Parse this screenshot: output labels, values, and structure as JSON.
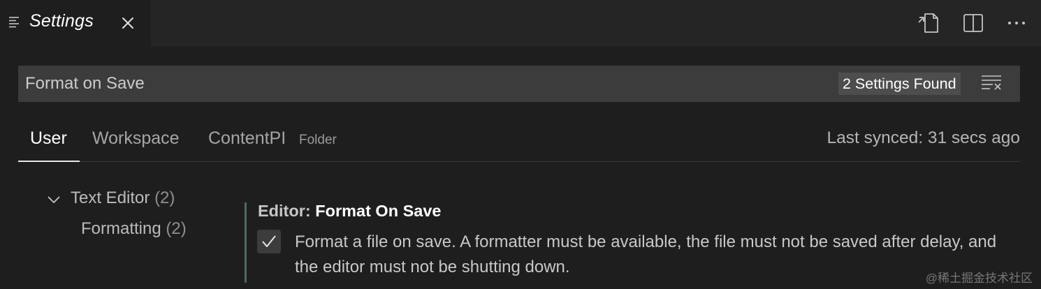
{
  "editor_tab": {
    "title": "Settings",
    "icon": "settings-editor-icon",
    "close_icon": "close-icon"
  },
  "actions": [
    {
      "name": "open-settings-json-button",
      "icon": "open-json-icon"
    },
    {
      "name": "split-editor-button",
      "icon": "split-editor-icon"
    },
    {
      "name": "more-actions-button",
      "icon": "ellipsis-icon"
    }
  ],
  "search": {
    "value": "Format on Save",
    "results_label": "2 Settings Found",
    "clear_icon": "clear-filter-icon"
  },
  "scope_tabs": [
    {
      "label": "User",
      "active": true
    },
    {
      "label": "Workspace",
      "active": false
    },
    {
      "label": "ContentPI",
      "active": false,
      "hint": "Folder"
    }
  ],
  "sync_status": "Last synced: 31 secs ago",
  "toc": {
    "group": {
      "label": "Text Editor",
      "count": "(2)"
    },
    "child": {
      "label": "Formatting",
      "count": "(2)"
    }
  },
  "setting": {
    "category": "Editor: ",
    "name": "Format On Save",
    "checked": true,
    "description": "Format a file on save. A formatter must be available, the file must not be saved after delay, and the editor must not be shutting down."
  },
  "watermark": "@稀土掘金技术社区",
  "colors": {
    "background": "#1e1e1e",
    "tab_bar": "#252526",
    "input_background": "#3c3c3c",
    "setting_indicator": "#4e6a5e"
  }
}
